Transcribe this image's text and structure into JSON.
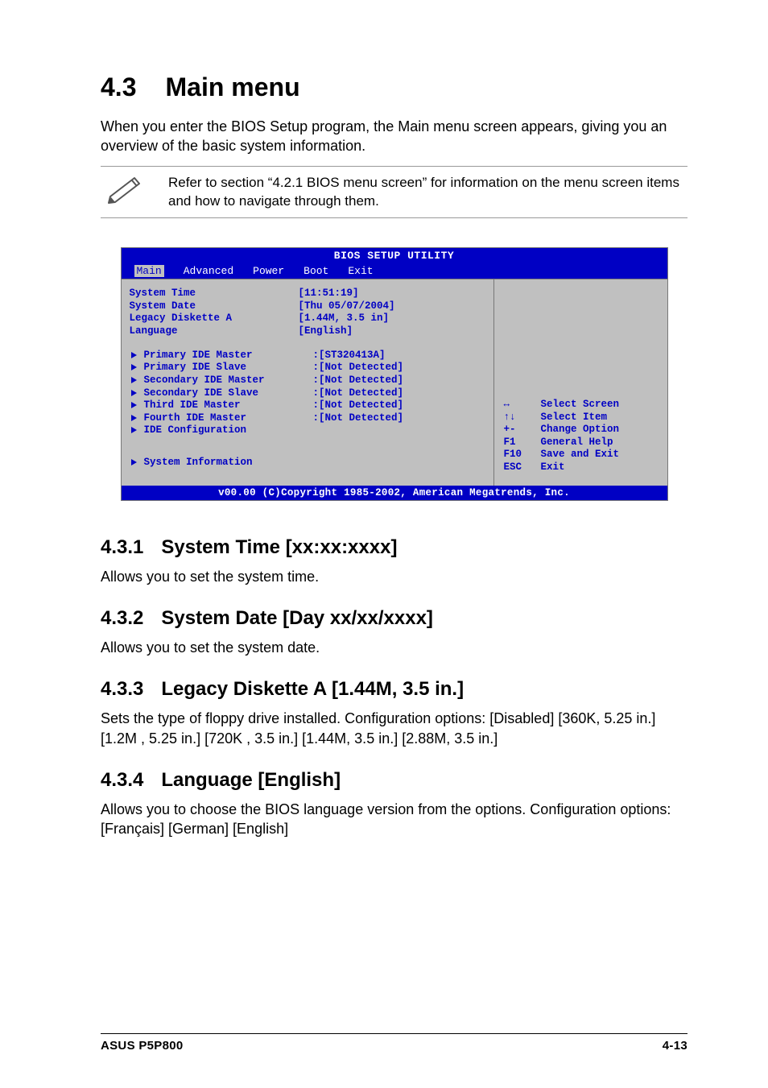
{
  "section": {
    "num": "4.3",
    "title": "Main menu"
  },
  "intro": "When you enter the BIOS Setup program, the Main menu screen appears, giving you an overview of the basic system information.",
  "note": "Refer to section “4.2.1  BIOS menu screen” for information on the menu screen items and how to navigate through them.",
  "bios": {
    "title": "BIOS SETUP UTILITY",
    "menu": {
      "main": "Main",
      "advanced": "Advanced",
      "power": "Power",
      "boot": "Boot",
      "exit": "Exit"
    },
    "items": {
      "system_time": {
        "label": "System Time",
        "value": "[11:51:19]"
      },
      "system_date": {
        "label": "System Date",
        "value": "[Thu 05/07/2004]"
      },
      "legacy_disk": {
        "label": "Legacy Diskette A",
        "value": "[1.44M, 3.5 in]"
      },
      "language": {
        "label": "Language",
        "value": "[English]"
      },
      "pri_ide_m": {
        "label": "Primary IDE Master",
        "value": ":[ST320413A]"
      },
      "pri_ide_s": {
        "label": "Primary IDE Slave",
        "value": ":[Not Detected]"
      },
      "sec_ide_m": {
        "label": "Secondary IDE Master",
        "value": ":[Not Detected]"
      },
      "sec_ide_s": {
        "label": "Secondary IDE Slave",
        "value": ":[Not Detected]"
      },
      "thi_ide_m": {
        "label": "Third IDE Master",
        "value": ":[Not Detected]"
      },
      "fou_ide_m": {
        "label": "Fourth IDE Master",
        "value": ":[Not Detected]"
      },
      "ide_cfg": {
        "label": "IDE Configuration",
        "value": ""
      },
      "sys_info": {
        "label": "System Information",
        "value": ""
      }
    },
    "help": [
      {
        "key": "↔",
        "text": "Select Screen"
      },
      {
        "key": "↑↓",
        "text": "Select Item"
      },
      {
        "key": "+-",
        "text": "Change Option"
      },
      {
        "key": "F1",
        "text": "General Help"
      },
      {
        "key": "F10",
        "text": "Save and Exit"
      },
      {
        "key": "ESC",
        "text": "Exit"
      }
    ],
    "footer": "v00.00 (C)Copyright 1985-2002, American Megatrends, Inc."
  },
  "subs": {
    "s1": {
      "num": "4.3.1",
      "title": "System Time [xx:xx:xxxx]",
      "body": "Allows you to set the system time."
    },
    "s2": {
      "num": "4.3.2",
      "title": "System Date [Day xx/xx/xxxx]",
      "body": "Allows you to set the system date."
    },
    "s3": {
      "num": "4.3.3",
      "title": "Legacy Diskette A [1.44M, 3.5 in.]",
      "body": "Sets the type of floppy drive installed. Configuration options: [Disabled] [360K, 5.25 in.] [1.2M , 5.25 in.] [720K , 3.5 in.] [1.44M, 3.5 in.] [2.88M, 3.5 in.]"
    },
    "s4": {
      "num": "4.3.4",
      "title": "Language [English]",
      "body": "Allows you to choose the BIOS language version from the options. Configuration options: [Français] [German] [English]"
    }
  },
  "footer": {
    "left": "ASUS P5P800",
    "right": "4-13"
  }
}
